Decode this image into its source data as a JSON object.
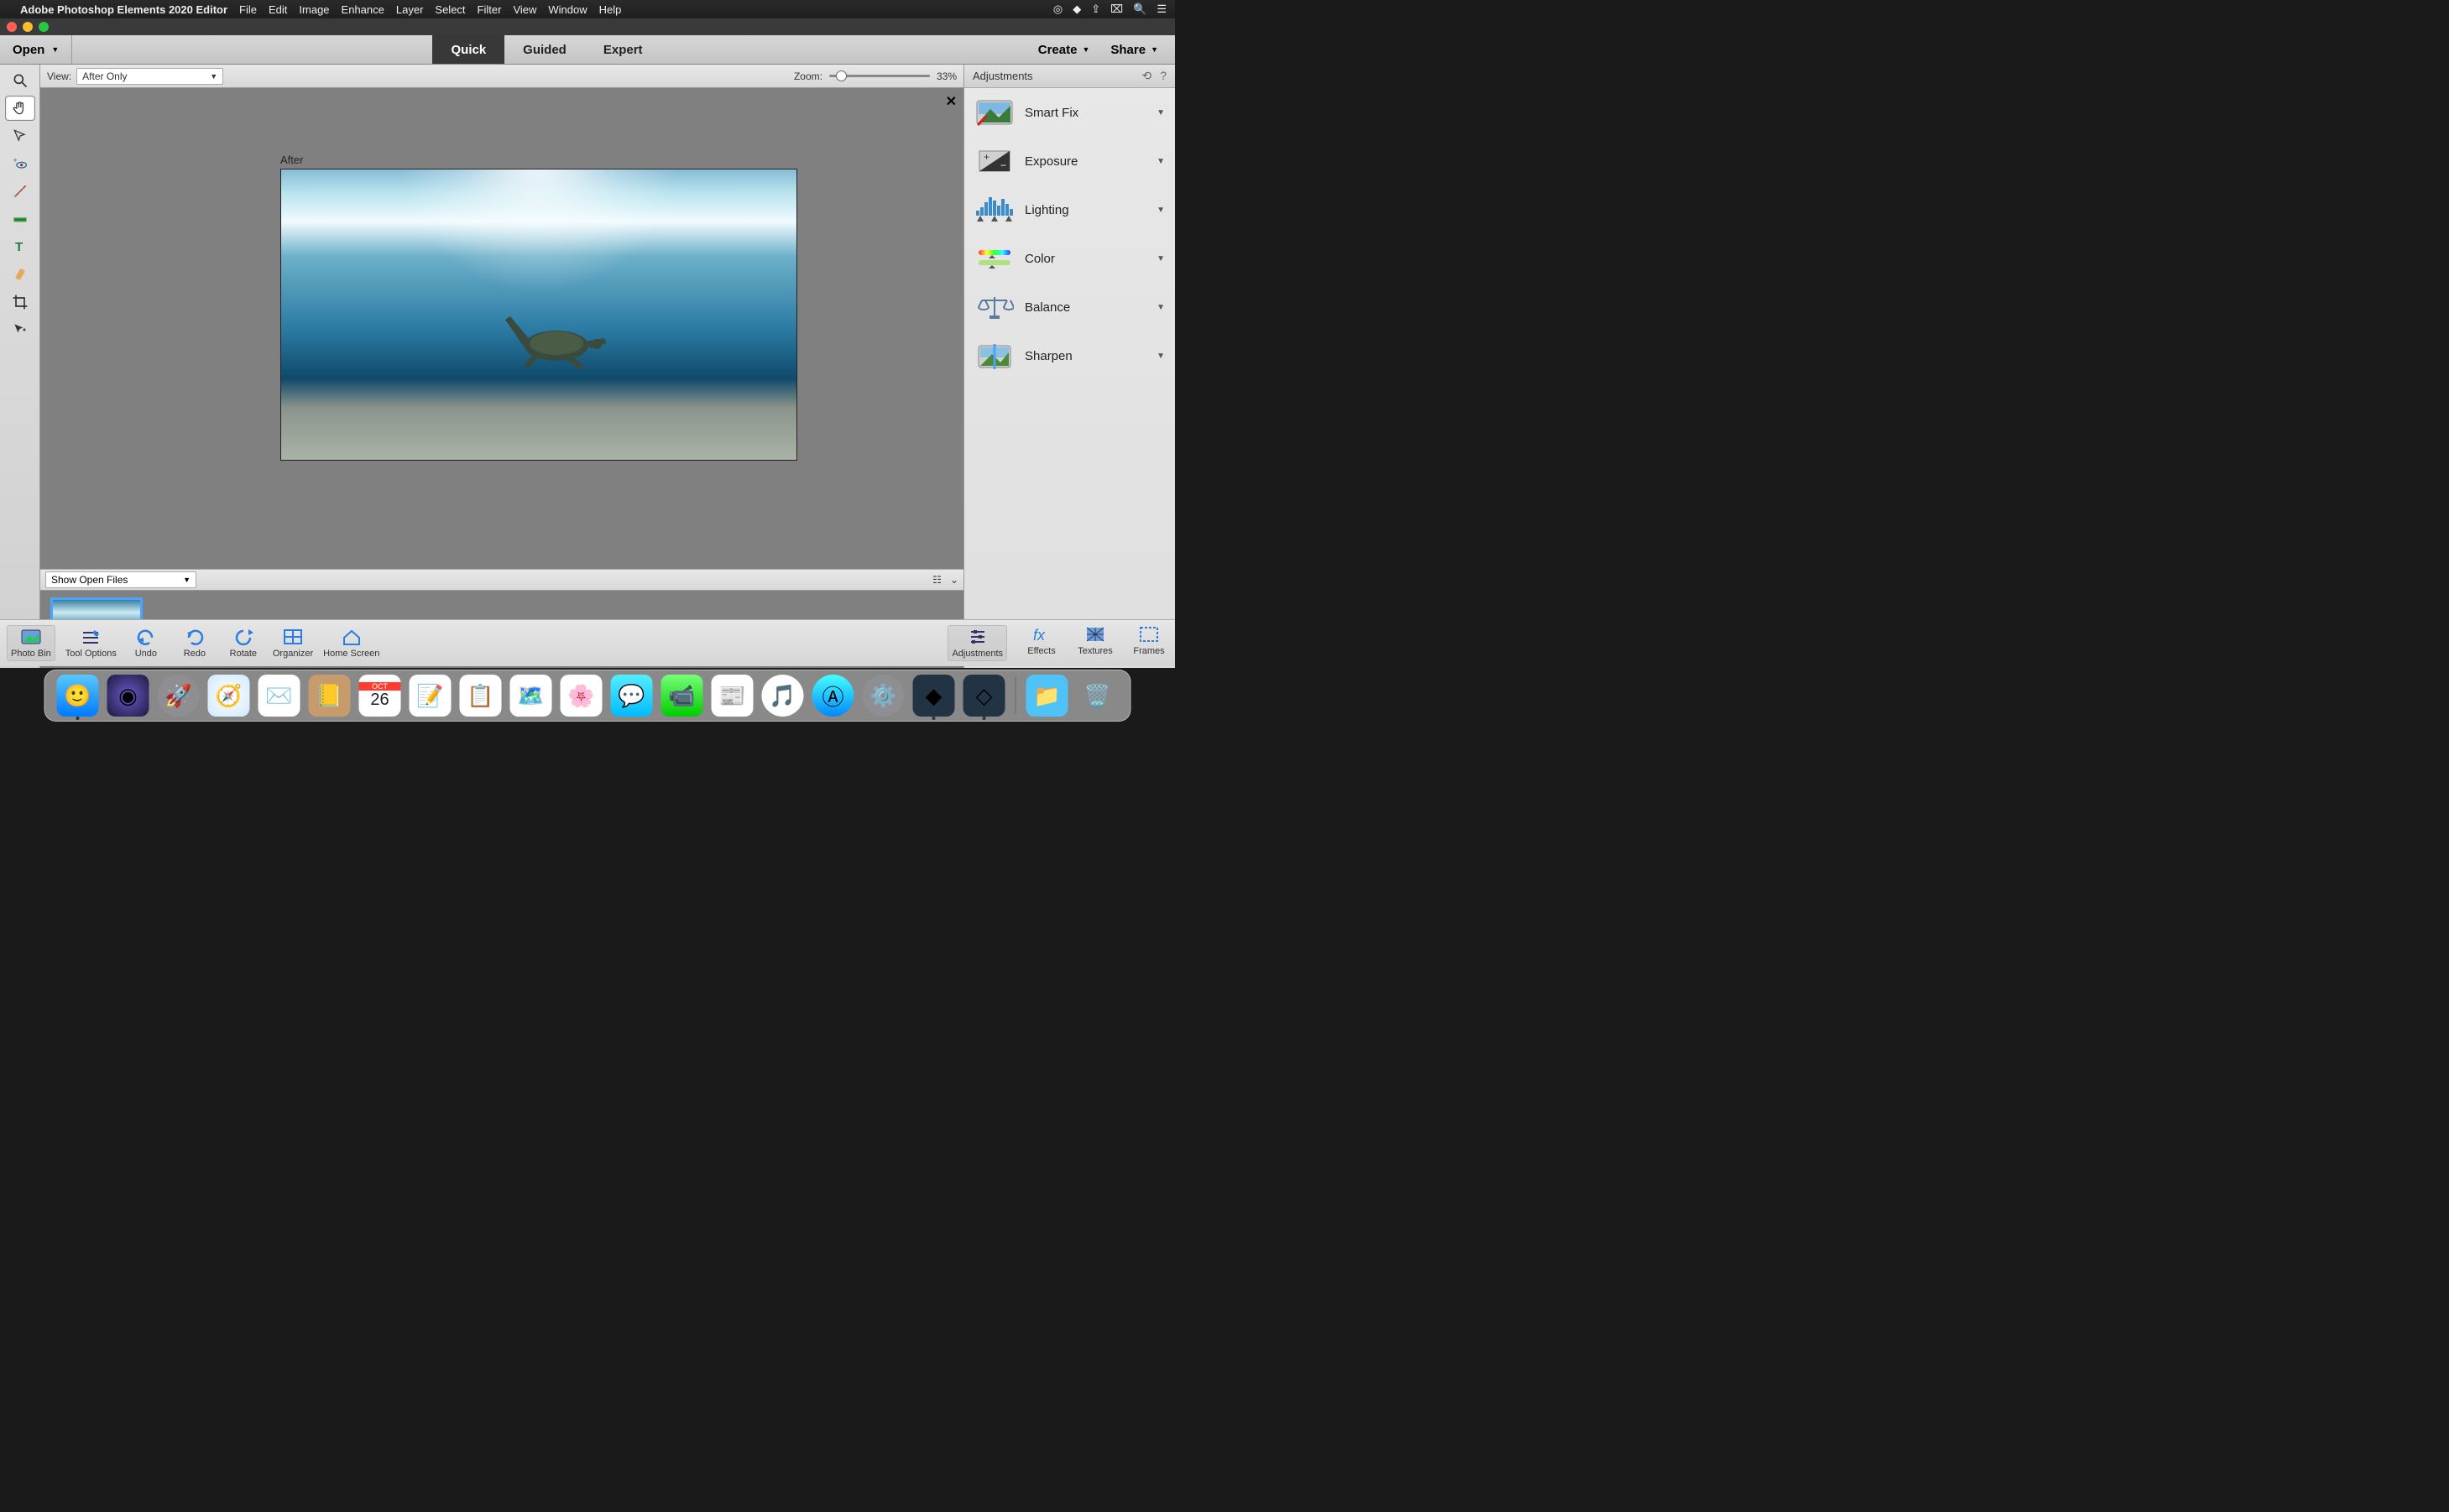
{
  "menubar": {
    "app_name": "Adobe Photoshop Elements 2020 Editor",
    "items": [
      "File",
      "Edit",
      "Image",
      "Enhance",
      "Layer",
      "Select",
      "Filter",
      "View",
      "Window",
      "Help"
    ]
  },
  "toolbar": {
    "open_label": "Open",
    "modes": {
      "quick": "Quick",
      "guided": "Guided",
      "expert": "Expert",
      "active": "quick"
    },
    "create_label": "Create",
    "share_label": "Share"
  },
  "options": {
    "view_label": "View:",
    "view_value": "After Only",
    "zoom_label": "Zoom:",
    "zoom_value": "33%",
    "zoom_fraction": 0.1
  },
  "canvas": {
    "after_label": "After"
  },
  "photoBin": {
    "dropdown": "Show Open Files"
  },
  "adjustments": {
    "title": "Adjustments",
    "items": [
      {
        "key": "smartfix",
        "label": "Smart Fix"
      },
      {
        "key": "exposure",
        "label": "Exposure"
      },
      {
        "key": "lighting",
        "label": "Lighting"
      },
      {
        "key": "color",
        "label": "Color"
      },
      {
        "key": "balance",
        "label": "Balance"
      },
      {
        "key": "sharpen",
        "label": "Sharpen"
      }
    ]
  },
  "footer": {
    "left": [
      {
        "key": "photo-bin",
        "label": "Photo Bin"
      },
      {
        "key": "tool-options",
        "label": "Tool Options"
      },
      {
        "key": "undo",
        "label": "Undo"
      },
      {
        "key": "redo",
        "label": "Redo"
      },
      {
        "key": "rotate",
        "label": "Rotate"
      },
      {
        "key": "organizer",
        "label": "Organizer"
      },
      {
        "key": "home-screen",
        "label": "Home Screen"
      }
    ],
    "right": [
      {
        "key": "adjustments",
        "label": "Adjustments"
      },
      {
        "key": "effects",
        "label": "Effects"
      },
      {
        "key": "textures",
        "label": "Textures"
      },
      {
        "key": "frames",
        "label": "Frames"
      }
    ]
  },
  "dock": {
    "items": [
      "finder",
      "siri",
      "launchpad",
      "safari",
      "mail",
      "contacts",
      "calendar",
      "notes",
      "reminders",
      "maps",
      "photos",
      "messages",
      "facetime",
      "news",
      "music",
      "appstore",
      "settings",
      "pse-organizer",
      "pse-editor"
    ],
    "calendar": {
      "month": "OCT",
      "day": "26"
    },
    "trash": "trash",
    "downloads": "downloads"
  }
}
